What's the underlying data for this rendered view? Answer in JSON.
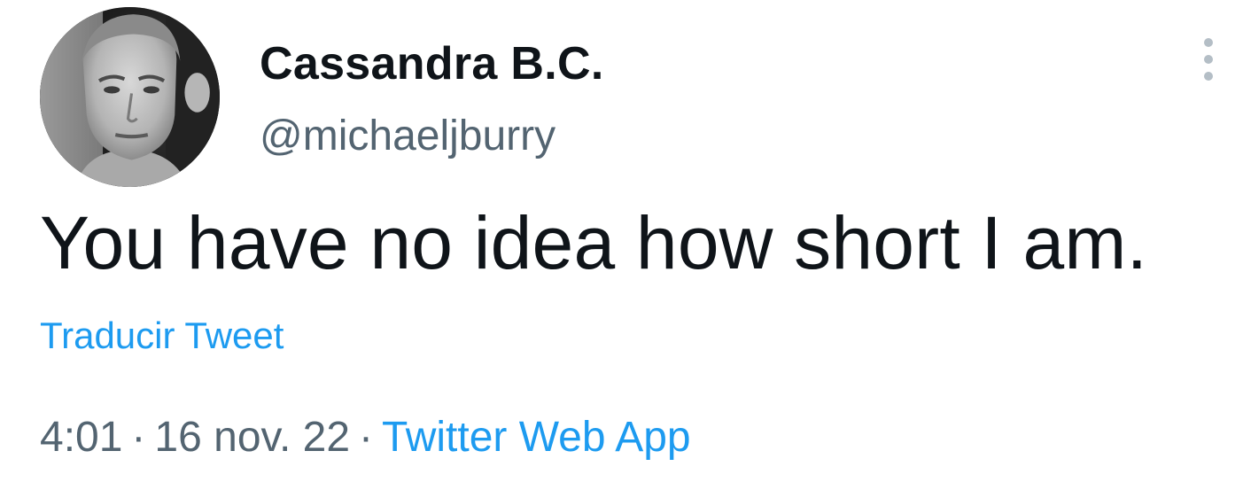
{
  "tweet": {
    "author": {
      "display_name": "Cassandra B.C.",
      "handle": "@michaeljburry",
      "avatar_icon": "profile-photo"
    },
    "more_icon": "more-vertical-icon",
    "text": "You have no idea how short I am.",
    "translate_label": "Traducir Tweet",
    "meta": {
      "time": "4:01",
      "separator": "·",
      "date": "16 nov. 22",
      "source": "Twitter Web App"
    }
  },
  "colors": {
    "text_primary": "#0f1419",
    "text_secondary": "#536471",
    "link": "#1d9bf0",
    "more_dots": "#b4bec6",
    "background": "#ffffff"
  }
}
